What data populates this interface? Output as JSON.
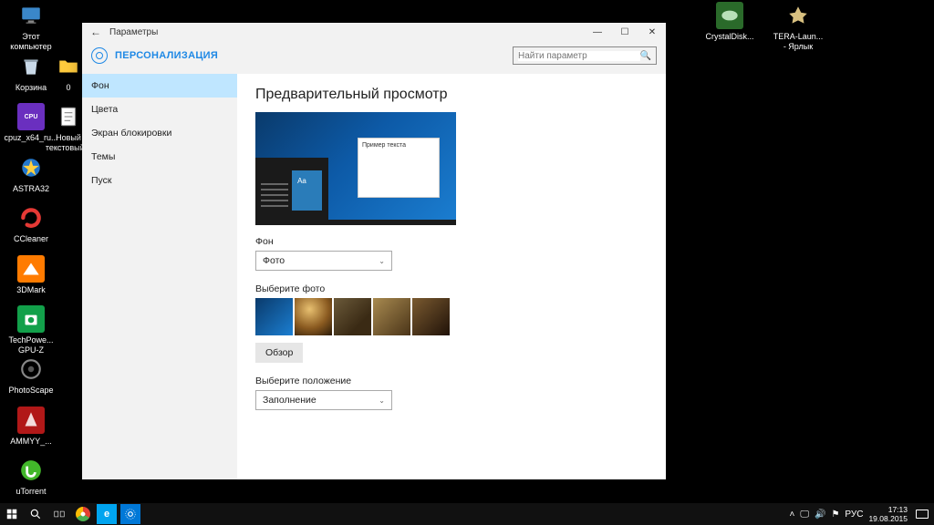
{
  "desktop": {
    "icons_left": [
      {
        "label": "Этот\nкомпьютер"
      },
      {
        "label": "Корзина"
      },
      {
        "label": "cpuz_x64_ru..."
      },
      {
        "label": "ASTRA32"
      },
      {
        "label": "CCleaner"
      },
      {
        "label": "3DMark"
      },
      {
        "label": "TechPowe...\nGPU-Z"
      },
      {
        "label": "PhotoScape"
      },
      {
        "label": "AMMYY_..."
      },
      {
        "label": "uTorrent"
      }
    ],
    "icons_left2": [
      {
        "label": "0"
      },
      {
        "label": "Новый\nтекстовый..."
      }
    ],
    "icons_right": [
      {
        "label": "CrystalDisk..."
      },
      {
        "label": "TERA-Laun...\n- Ярлык"
      }
    ]
  },
  "window": {
    "titlebar_title": "Параметры",
    "heading": "ПЕРСОНАЛИЗАЦИЯ",
    "search_placeholder": "Найти параметр",
    "sidebar": [
      "Фон",
      "Цвета",
      "Экран блокировки",
      "Темы",
      "Пуск"
    ],
    "preview_heading": "Предварительный просмотр",
    "preview_sample_text": "Пример текста",
    "preview_aa": "Aa",
    "section_background_label": "Фон",
    "dropdown_background_value": "Фото",
    "section_choose_photo": "Выберите фото",
    "browse_button": "Обзор",
    "section_fit": "Выберите положение",
    "dropdown_fit_value": "Заполнение"
  },
  "taskbar": {
    "lang": "РУС",
    "time": "17:13",
    "date": "19.08.2015"
  }
}
